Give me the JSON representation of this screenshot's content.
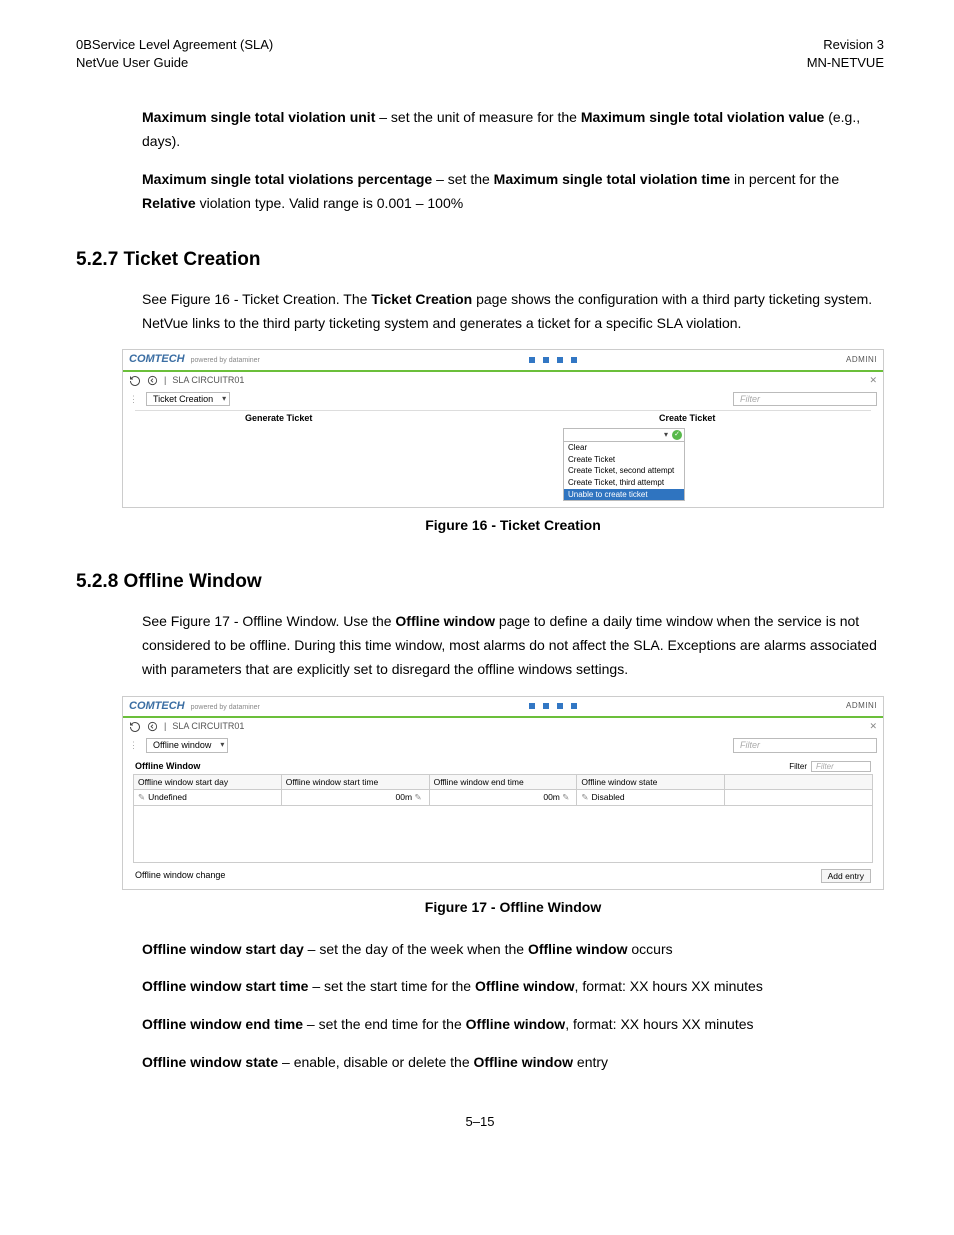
{
  "header": {
    "left1": "0BService Level Agreement (SLA)",
    "left2": "NetVue User Guide",
    "right1": "Revision 3",
    "right2": "MN-NETVUE"
  },
  "para1": {
    "b1": "Maximum single total violation unit",
    "t1": " – set the unit of measure for the ",
    "b2": "Maximum single total violation value",
    "t2": " (e.g., days)."
  },
  "para2": {
    "b1": "Maximum single total violations percentage",
    "t1": " – set the ",
    "b2": "Maximum single total violation time",
    "t2": " in percent for the ",
    "b3": "Relative",
    "t3": " violation type. Valid range is 0.001 – 100%"
  },
  "sec527": {
    "heading": "5.2.7  Ticket Creation",
    "p_a": "See Figure 16 - Ticket Creation. The ",
    "p_b": "Ticket Creation",
    "p_c": " page shows the configuration with a third party ticketing system. NetVue links to the third party ticketing system and generates a ticket for a specific SLA violation.",
    "figcap": "Figure 16 - Ticket Creation"
  },
  "fig16": {
    "logo": "COMTECH",
    "logosub": "powered by dataminer",
    "admin": "ADMINI",
    "crumb": "SLA CIRCUITR01",
    "close": "✕",
    "dropdown": "Ticket Creation",
    "filter": "Filter",
    "col1": "Generate Ticket",
    "col2": "Create Ticket",
    "dd_items": [
      "Clear",
      "Create Ticket",
      "Create Ticket, second attempt",
      "Create Ticket, third attempt",
      "Unable to create ticket"
    ]
  },
  "sec528": {
    "heading": "5.2.8  Offline Window",
    "p_a": "See Figure 17 - Offline Window. Use the ",
    "p_b": "Offline window",
    "p_c": " page to define a daily time window when the service is not considered to be offline. During this time window, most alarms do not affect the SLA. Exceptions are alarms associated with parameters that are explicitly set to disregard the offline windows settings.",
    "figcap": "Figure 17 - Offline Window"
  },
  "fig17": {
    "logo": "COMTECH",
    "logosub": "powered by dataminer",
    "admin": "ADMINI",
    "crumb": "SLA CIRCUITR01",
    "close": "✕",
    "dropdown": "Offline window",
    "filter": "Filter",
    "title": "Offline Window",
    "flt_label": "Filter",
    "flt_ph": "Filter",
    "cols": [
      "Offline window start day",
      "Offline window start time",
      "Offline window end time",
      "Offline window state",
      ""
    ],
    "row": [
      "Undefined",
      "00m",
      "00m",
      "Disabled",
      ""
    ],
    "footer": "Offline window change",
    "btn": "Add entry"
  },
  "defs": {
    "d1b": "Offline window start day",
    "d1t": " – set the day of the week when the ",
    "d1b2": "Offline window",
    "d1t2": " occurs",
    "d2b": "Offline window start time",
    "d2t": " – set the start time for the ",
    "d2b2": "Offline window",
    "d2t2": ", format: XX hours XX minutes",
    "d3b": "Offline window end time",
    "d3t": " – set the end time for the ",
    "d3b2": "Offline window",
    "d3t2": ", format: XX hours XX minutes",
    "d4b": "Offline window state",
    "d4t": " – enable, disable or delete the ",
    "d4b2": "Offline window",
    "d4t2": " entry"
  },
  "pagenum": "5–15"
}
